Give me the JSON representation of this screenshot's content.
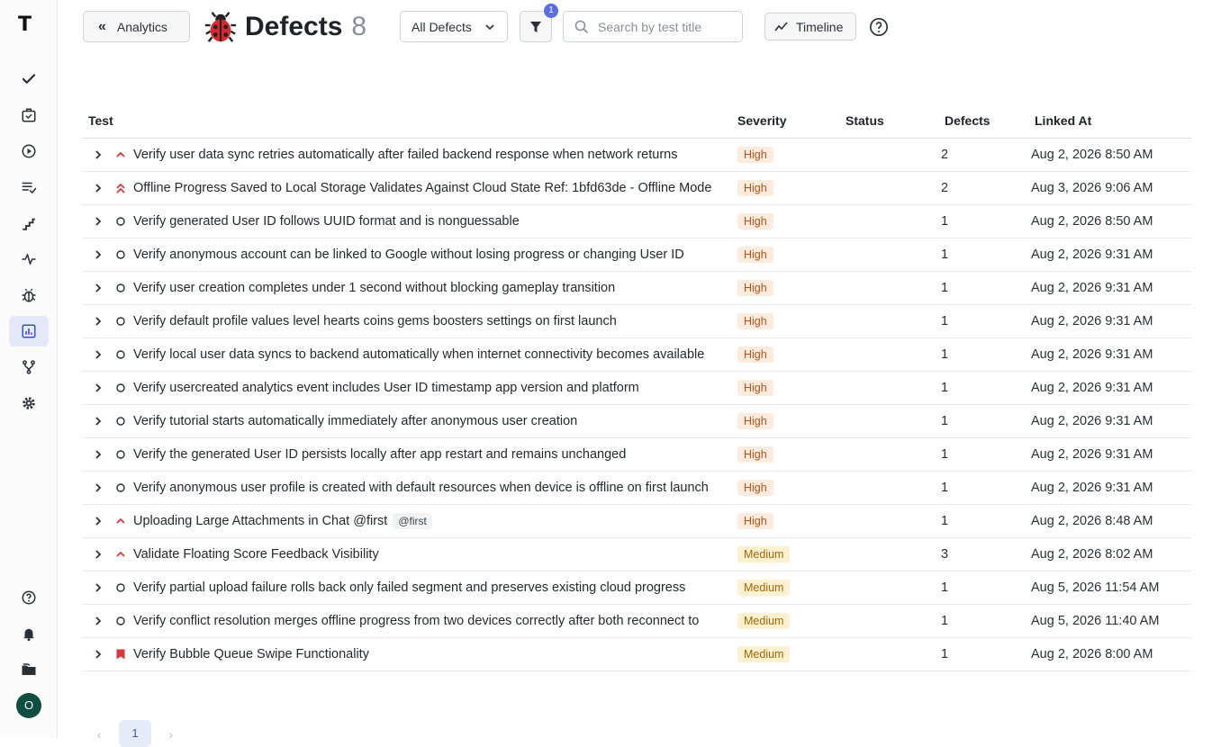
{
  "sidebar": {
    "logo": "T",
    "user_initial": "O",
    "items": [
      {
        "icon": "check-icon"
      },
      {
        "icon": "briefcase-check-icon"
      },
      {
        "icon": "play-circle-icon"
      },
      {
        "icon": "list-check-icon"
      },
      {
        "icon": "stairs-icon"
      },
      {
        "icon": "pulse-icon"
      },
      {
        "icon": "bug-icon"
      },
      {
        "icon": "bar-chart-icon",
        "active": true
      },
      {
        "icon": "git-branch-icon"
      },
      {
        "icon": "gear-icon"
      }
    ],
    "bottom": [
      {
        "icon": "help-circle-icon"
      },
      {
        "icon": "bell-icon"
      },
      {
        "icon": "folder-icon"
      }
    ]
  },
  "header": {
    "back_label": "Analytics",
    "title": "Defects",
    "count": "8",
    "filter_select": "All Defects",
    "filter_badge": "1",
    "search_placeholder": "Search by test title",
    "timeline_label": "Timeline"
  },
  "table": {
    "columns": [
      "Test",
      "Severity",
      "Status",
      "Defects",
      "Linked At"
    ],
    "rows": [
      {
        "prio": "up",
        "title": "Verify user data sync retries automatically after failed backend response when network returns",
        "tag": "",
        "severity": "High",
        "status": "",
        "defects": "2",
        "linked": "Aug 2, 2026 8:50 AM"
      },
      {
        "prio": "double-up",
        "title": "Offline Progress Saved to Local Storage Validates Against Cloud State Ref: 1bfd63de - Offline Mode",
        "tag": "",
        "severity": "High",
        "status": "",
        "defects": "2",
        "linked": "Aug 3, 2026 9:06 AM"
      },
      {
        "prio": "circle",
        "title": "Verify generated User ID follows UUID format and is nonguessable",
        "tag": "",
        "severity": "High",
        "status": "",
        "defects": "1",
        "linked": "Aug 2, 2026 8:50 AM"
      },
      {
        "prio": "circle",
        "title": "Verify anonymous account can be linked to Google without losing progress or changing User ID",
        "tag": "",
        "severity": "High",
        "status": "",
        "defects": "1",
        "linked": "Aug 2, 2026 9:31 AM"
      },
      {
        "prio": "circle",
        "title": "Verify user creation completes under 1 second without blocking gameplay transition",
        "tag": "",
        "severity": "High",
        "status": "",
        "defects": "1",
        "linked": "Aug 2, 2026 9:31 AM"
      },
      {
        "prio": "circle",
        "title": "Verify default profile values level hearts coins gems boosters settings on first launch",
        "tag": "",
        "severity": "High",
        "status": "",
        "defects": "1",
        "linked": "Aug 2, 2026 9:31 AM"
      },
      {
        "prio": "circle",
        "title": "Verify local user data syncs to backend automatically when internet connectivity becomes available",
        "tag": "",
        "severity": "High",
        "status": "",
        "defects": "1",
        "linked": "Aug 2, 2026 9:31 AM"
      },
      {
        "prio": "circle",
        "title": "Verify usercreated analytics event includes User ID timestamp app version and platform",
        "tag": "",
        "severity": "High",
        "status": "",
        "defects": "1",
        "linked": "Aug 2, 2026 9:31 AM"
      },
      {
        "prio": "circle",
        "title": "Verify tutorial starts automatically immediately after anonymous user creation",
        "tag": "",
        "severity": "High",
        "status": "",
        "defects": "1",
        "linked": "Aug 2, 2026 9:31 AM"
      },
      {
        "prio": "circle",
        "title": "Verify the generated User ID persists locally after app restart and remains unchanged",
        "tag": "",
        "severity": "High",
        "status": "",
        "defects": "1",
        "linked": "Aug 2, 2026 9:31 AM"
      },
      {
        "prio": "circle",
        "title": "Verify anonymous user profile is created with default resources when device is offline on first launch",
        "tag": "",
        "severity": "High",
        "status": "",
        "defects": "1",
        "linked": "Aug 2, 2026 9:31 AM"
      },
      {
        "prio": "up",
        "title": "Uploading Large Attachments in Chat @first",
        "tag": "@first",
        "severity": "High",
        "status": "",
        "defects": "1",
        "linked": "Aug 2, 2026 8:48 AM"
      },
      {
        "prio": "up",
        "title": "Validate Floating Score Feedback Visibility",
        "tag": "",
        "severity": "Medium",
        "status": "",
        "defects": "3",
        "linked": "Aug 2, 2026 8:02 AM"
      },
      {
        "prio": "circle",
        "title": "Verify partial upload failure rolls back only failed segment and preserves existing cloud progress",
        "tag": "",
        "severity": "Medium",
        "status": "",
        "defects": "1",
        "linked": "Aug 5, 2026 11:54 AM"
      },
      {
        "prio": "circle",
        "title": "Verify conflict resolution merges offline progress from two devices correctly after both reconnect to",
        "tag": "",
        "severity": "Medium",
        "status": "",
        "defects": "1",
        "linked": "Aug 5, 2026 11:40 AM"
      },
      {
        "prio": "flag",
        "title": "Verify Bubble Queue Swipe Functionality",
        "tag": "",
        "severity": "Medium",
        "status": "",
        "defects": "1",
        "linked": "Aug 2, 2026 8:00 AM"
      }
    ]
  },
  "pagination": {
    "current": "1",
    "prev": "‹",
    "next": "›"
  }
}
